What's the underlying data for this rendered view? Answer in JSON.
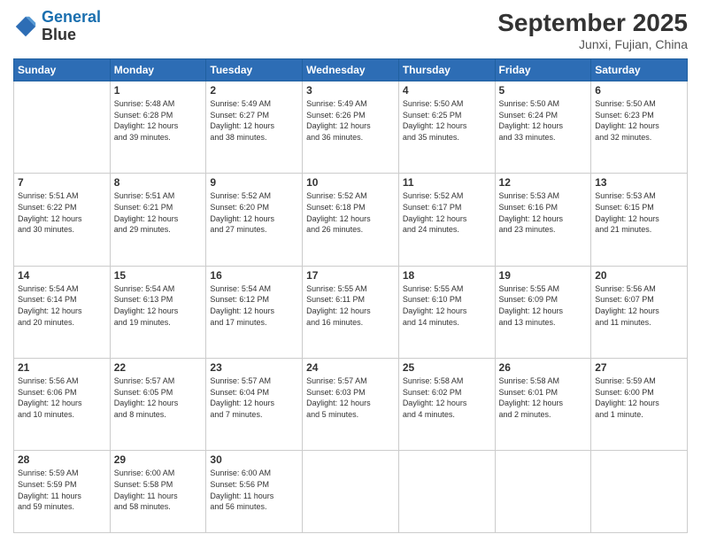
{
  "header": {
    "logo_line1": "General",
    "logo_line2": "Blue",
    "month": "September 2025",
    "location": "Junxi, Fujian, China"
  },
  "weekdays": [
    "Sunday",
    "Monday",
    "Tuesday",
    "Wednesday",
    "Thursday",
    "Friday",
    "Saturday"
  ],
  "weeks": [
    [
      {
        "day": "",
        "info": ""
      },
      {
        "day": "1",
        "info": "Sunrise: 5:48 AM\nSunset: 6:28 PM\nDaylight: 12 hours\nand 39 minutes."
      },
      {
        "day": "2",
        "info": "Sunrise: 5:49 AM\nSunset: 6:27 PM\nDaylight: 12 hours\nand 38 minutes."
      },
      {
        "day": "3",
        "info": "Sunrise: 5:49 AM\nSunset: 6:26 PM\nDaylight: 12 hours\nand 36 minutes."
      },
      {
        "day": "4",
        "info": "Sunrise: 5:50 AM\nSunset: 6:25 PM\nDaylight: 12 hours\nand 35 minutes."
      },
      {
        "day": "5",
        "info": "Sunrise: 5:50 AM\nSunset: 6:24 PM\nDaylight: 12 hours\nand 33 minutes."
      },
      {
        "day": "6",
        "info": "Sunrise: 5:50 AM\nSunset: 6:23 PM\nDaylight: 12 hours\nand 32 minutes."
      }
    ],
    [
      {
        "day": "7",
        "info": "Sunrise: 5:51 AM\nSunset: 6:22 PM\nDaylight: 12 hours\nand 30 minutes."
      },
      {
        "day": "8",
        "info": "Sunrise: 5:51 AM\nSunset: 6:21 PM\nDaylight: 12 hours\nand 29 minutes."
      },
      {
        "day": "9",
        "info": "Sunrise: 5:52 AM\nSunset: 6:20 PM\nDaylight: 12 hours\nand 27 minutes."
      },
      {
        "day": "10",
        "info": "Sunrise: 5:52 AM\nSunset: 6:18 PM\nDaylight: 12 hours\nand 26 minutes."
      },
      {
        "day": "11",
        "info": "Sunrise: 5:52 AM\nSunset: 6:17 PM\nDaylight: 12 hours\nand 24 minutes."
      },
      {
        "day": "12",
        "info": "Sunrise: 5:53 AM\nSunset: 6:16 PM\nDaylight: 12 hours\nand 23 minutes."
      },
      {
        "day": "13",
        "info": "Sunrise: 5:53 AM\nSunset: 6:15 PM\nDaylight: 12 hours\nand 21 minutes."
      }
    ],
    [
      {
        "day": "14",
        "info": "Sunrise: 5:54 AM\nSunset: 6:14 PM\nDaylight: 12 hours\nand 20 minutes."
      },
      {
        "day": "15",
        "info": "Sunrise: 5:54 AM\nSunset: 6:13 PM\nDaylight: 12 hours\nand 19 minutes."
      },
      {
        "day": "16",
        "info": "Sunrise: 5:54 AM\nSunset: 6:12 PM\nDaylight: 12 hours\nand 17 minutes."
      },
      {
        "day": "17",
        "info": "Sunrise: 5:55 AM\nSunset: 6:11 PM\nDaylight: 12 hours\nand 16 minutes."
      },
      {
        "day": "18",
        "info": "Sunrise: 5:55 AM\nSunset: 6:10 PM\nDaylight: 12 hours\nand 14 minutes."
      },
      {
        "day": "19",
        "info": "Sunrise: 5:55 AM\nSunset: 6:09 PM\nDaylight: 12 hours\nand 13 minutes."
      },
      {
        "day": "20",
        "info": "Sunrise: 5:56 AM\nSunset: 6:07 PM\nDaylight: 12 hours\nand 11 minutes."
      }
    ],
    [
      {
        "day": "21",
        "info": "Sunrise: 5:56 AM\nSunset: 6:06 PM\nDaylight: 12 hours\nand 10 minutes."
      },
      {
        "day": "22",
        "info": "Sunrise: 5:57 AM\nSunset: 6:05 PM\nDaylight: 12 hours\nand 8 minutes."
      },
      {
        "day": "23",
        "info": "Sunrise: 5:57 AM\nSunset: 6:04 PM\nDaylight: 12 hours\nand 7 minutes."
      },
      {
        "day": "24",
        "info": "Sunrise: 5:57 AM\nSunset: 6:03 PM\nDaylight: 12 hours\nand 5 minutes."
      },
      {
        "day": "25",
        "info": "Sunrise: 5:58 AM\nSunset: 6:02 PM\nDaylight: 12 hours\nand 4 minutes."
      },
      {
        "day": "26",
        "info": "Sunrise: 5:58 AM\nSunset: 6:01 PM\nDaylight: 12 hours\nand 2 minutes."
      },
      {
        "day": "27",
        "info": "Sunrise: 5:59 AM\nSunset: 6:00 PM\nDaylight: 12 hours\nand 1 minute."
      }
    ],
    [
      {
        "day": "28",
        "info": "Sunrise: 5:59 AM\nSunset: 5:59 PM\nDaylight: 11 hours\nand 59 minutes."
      },
      {
        "day": "29",
        "info": "Sunrise: 6:00 AM\nSunset: 5:58 PM\nDaylight: 11 hours\nand 58 minutes."
      },
      {
        "day": "30",
        "info": "Sunrise: 6:00 AM\nSunset: 5:56 PM\nDaylight: 11 hours\nand 56 minutes."
      },
      {
        "day": "",
        "info": ""
      },
      {
        "day": "",
        "info": ""
      },
      {
        "day": "",
        "info": ""
      },
      {
        "day": "",
        "info": ""
      }
    ]
  ]
}
